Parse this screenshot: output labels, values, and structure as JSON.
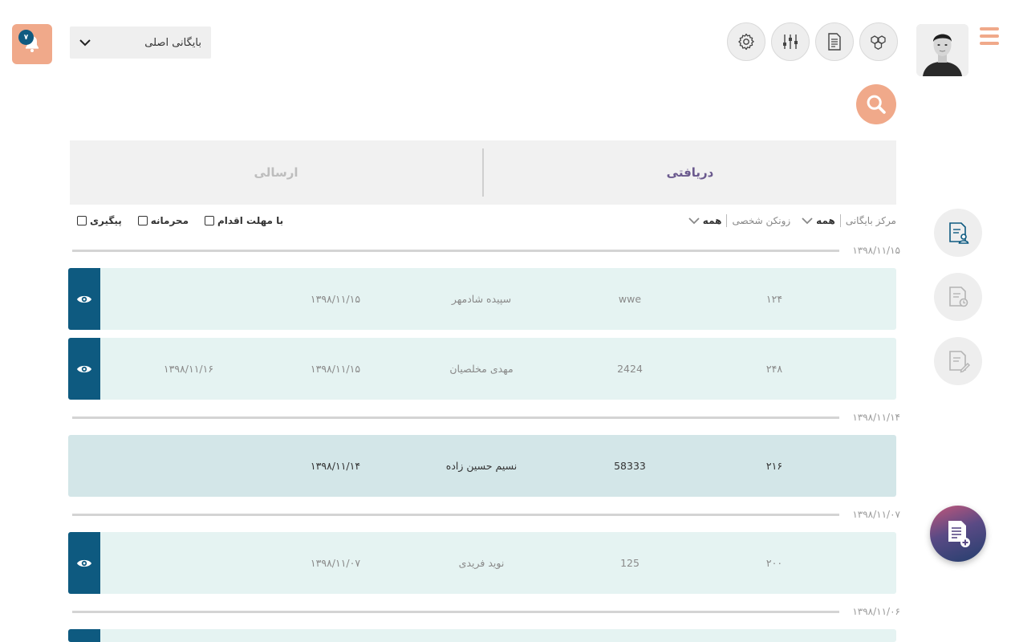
{
  "header": {
    "notification_count": "۷",
    "archive_select_value": "بایگانی اصلی",
    "tools": [
      {
        "icon": "gear-icon"
      },
      {
        "icon": "sliders-icon"
      },
      {
        "icon": "document-icon"
      },
      {
        "icon": "hexagon-nodes-icon"
      }
    ]
  },
  "tabs": {
    "received": "دریافتی",
    "sent": "ارسالی"
  },
  "filters": {
    "archive_center_label": "مرکز بایگانی",
    "archive_center_value": "همه",
    "personal_folder_label": "زونکن شخصی",
    "personal_folder_value": "همه",
    "follow_up": "پیگیری",
    "confidential": "محرمانه",
    "with_deadline": "با مهلت اقدام"
  },
  "groups": [
    {
      "date": "۱۳۹۸/۱۱/۱۵"
    },
    {
      "date": "۱۳۹۸/۱۱/۱۴"
    },
    {
      "date": "۱۳۹۸/۱۱/۰۷"
    },
    {
      "date": "۱۳۹۸/۱۱/۰۶"
    }
  ],
  "rows": [
    {
      "num": "۱۲۴",
      "code": "wwe",
      "name": "سپیده شادمهر",
      "date": "۱۳۹۸/۱۱/۱۵",
      "due": ""
    },
    {
      "num": "۲۴۸",
      "code": "2424",
      "name": "مهدی مخلصیان",
      "date": "۱۳۹۸/۱۱/۱۵",
      "due": "۱۳۹۸/۱۱/۱۶"
    },
    {
      "num": "۲۱۶",
      "code": "58333",
      "name": "نسیم حسین زاده",
      "date": "۱۳۹۸/۱۱/۱۴",
      "due": ""
    },
    {
      "num": "۲۰۰",
      "code": "125",
      "name": "نوید فریدی",
      "date": "۱۳۹۸/۱۱/۰۷",
      "due": ""
    }
  ],
  "colors": {
    "accent": "#f0a98a",
    "primary": "#0e5a80",
    "row_bg": "#e5f3f2",
    "row_selected_bg": "#d3e6e8",
    "tab_active": "#6b5a8e"
  }
}
